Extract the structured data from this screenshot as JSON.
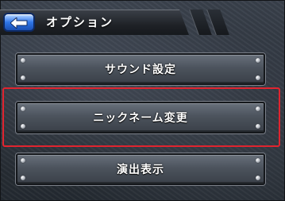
{
  "header": {
    "back_icon": "back-arrow-icon",
    "title": "オプション"
  },
  "options": [
    {
      "label": "サウンド設定"
    },
    {
      "label": "ニックネーム変更"
    },
    {
      "label": "演出表示"
    }
  ],
  "colors": {
    "highlight": "#e0242f",
    "back_button": "#2f76e8"
  }
}
